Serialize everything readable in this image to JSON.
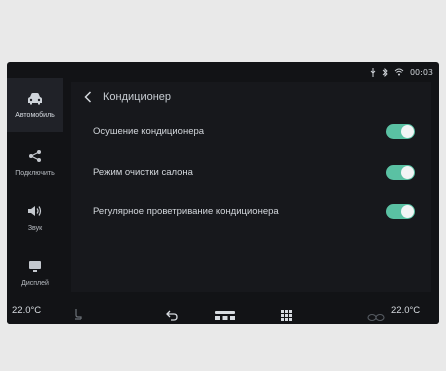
{
  "status": {
    "time": "00:03",
    "icons": [
      "usb-icon",
      "bluetooth-icon",
      "wifi-icon"
    ]
  },
  "sidebar": {
    "items": [
      {
        "label": "Автомобиль",
        "icon": "car-icon",
        "active": true
      },
      {
        "label": "Подключить",
        "icon": "share-icon",
        "active": false
      },
      {
        "label": "Звук",
        "icon": "speaker-icon",
        "active": false
      },
      {
        "label": "Дисплей",
        "icon": "display-icon",
        "active": false
      }
    ]
  },
  "page": {
    "title": "Кондиционер",
    "settings": [
      {
        "label": "Осушение кондиционера",
        "enabled": true
      },
      {
        "label": "Режим очистки салона",
        "enabled": true
      },
      {
        "label": "Регулярное проветривание кондиционера",
        "enabled": true
      }
    ]
  },
  "bottom": {
    "temp_left": "22.0°C",
    "temp_right": "22.0°C",
    "icons": [
      "seat-heat-icon",
      "back-icon",
      "hvac-icon",
      "apps-icon",
      "fan-icon"
    ]
  },
  "colors": {
    "accent": "#5ac1a3",
    "background": "#121316",
    "panel": "#17181c"
  }
}
